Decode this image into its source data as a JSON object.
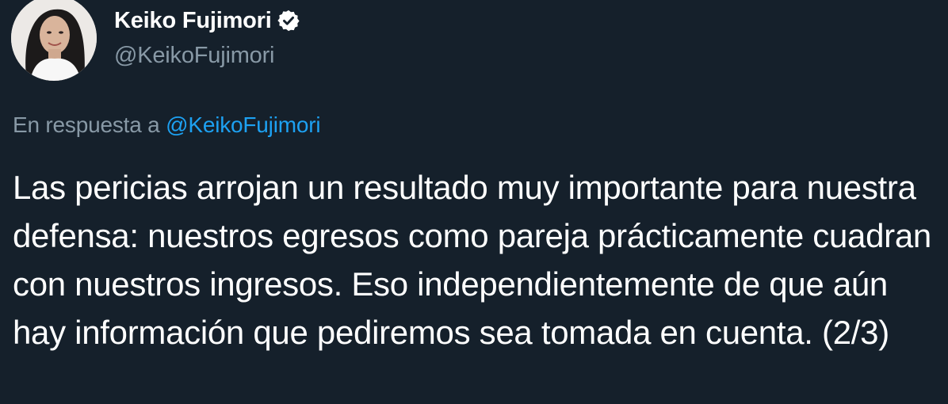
{
  "author": {
    "display_name": "Keiko Fujimori",
    "handle": "@KeikoFujimori",
    "verified": true,
    "avatar_icon": "profile-photo"
  },
  "reply": {
    "prefix": "En respuesta a",
    "mention": "@KeikoFujimori"
  },
  "tweet": {
    "text": "Las pericias arrojan un resultado muy importante para nuestra defensa: nuestros egresos como pareja prácticamente cuadran con nuestros ingresos. Eso independientemente de que aún hay información que pediremos sea tomada en cuenta. (2/3)"
  },
  "colors": {
    "background": "#15202b",
    "primary_text": "#ffffff",
    "secondary_text": "#8899a6",
    "link": "#1da1f2"
  }
}
